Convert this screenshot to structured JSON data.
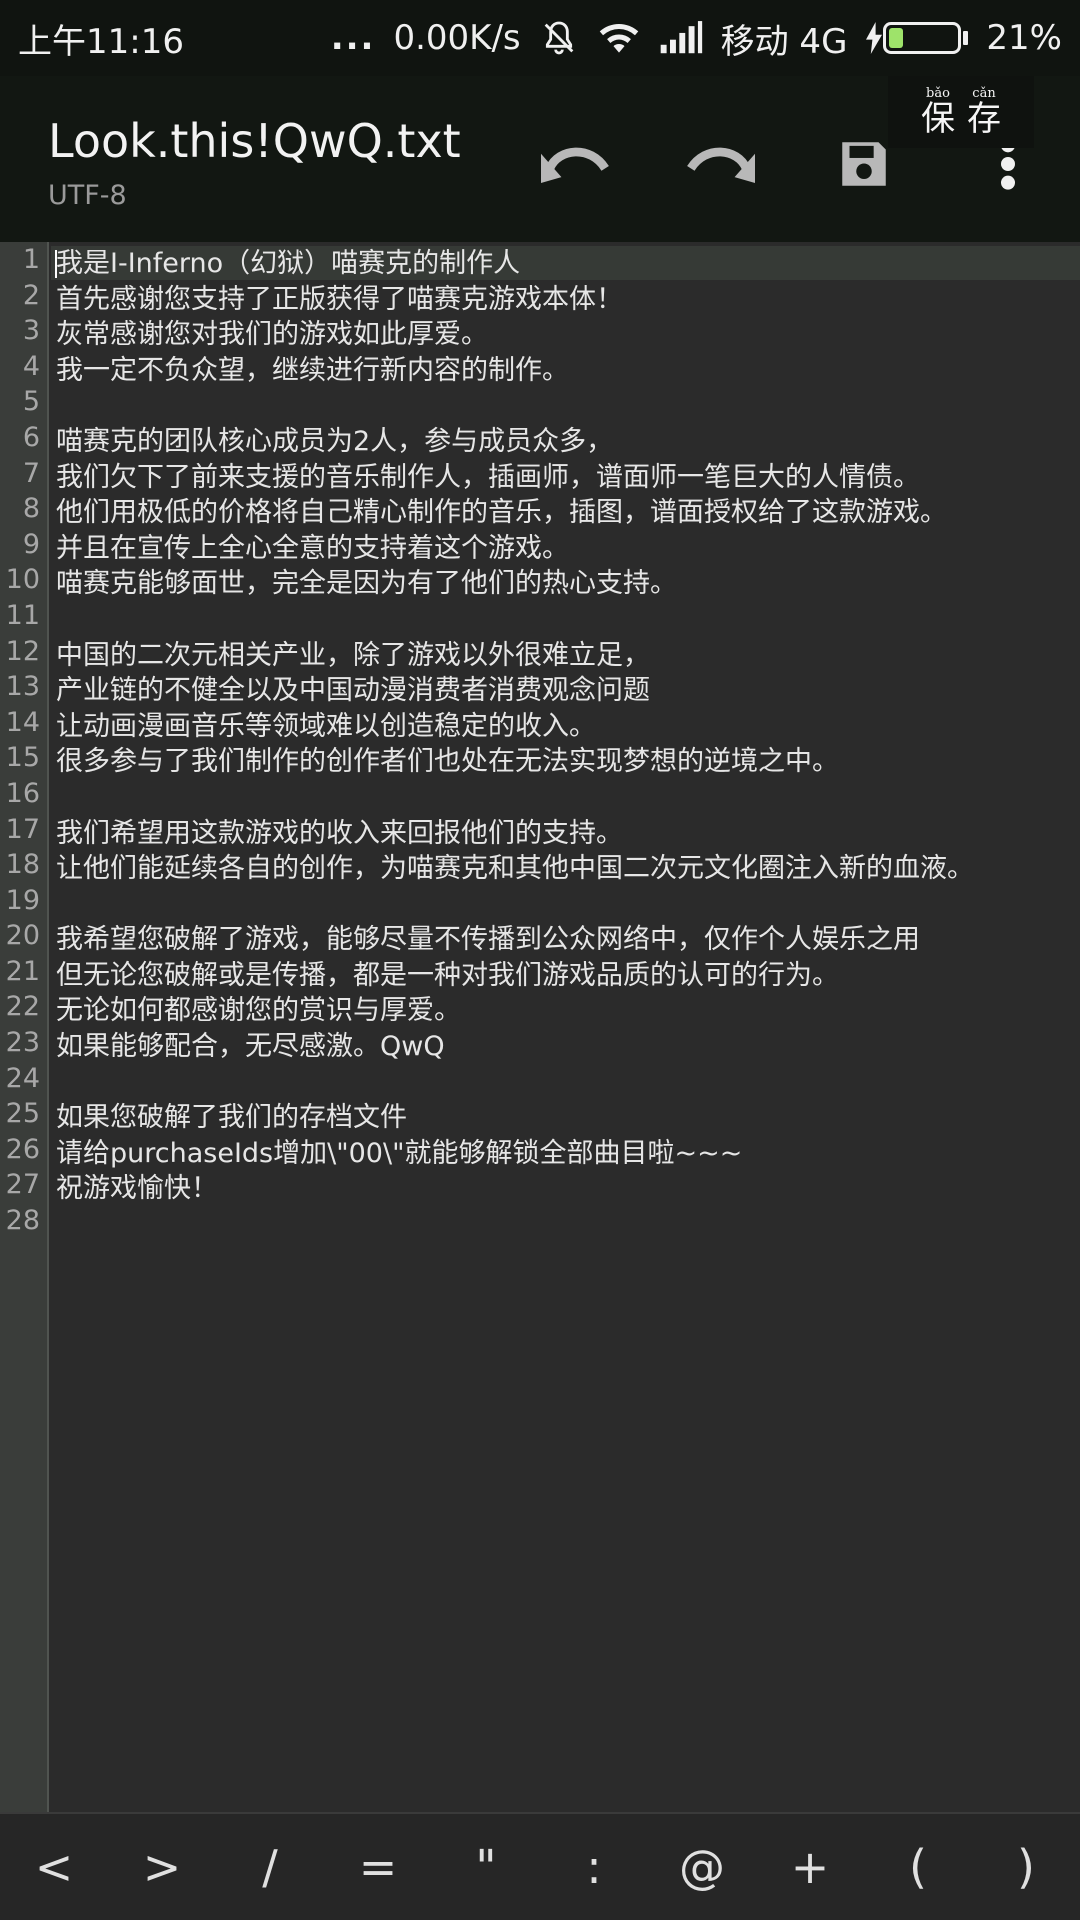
{
  "status_bar": {
    "time": "上午11:16",
    "dots": "...",
    "speed": "0.00K/s",
    "carrier": "移动 4G",
    "battery_percent": "21%",
    "battery_level": 0.21,
    "icons": [
      "bell-off-icon",
      "wifi-icon",
      "signal-icon",
      "charging-icon",
      "battery-icon"
    ]
  },
  "app_bar": {
    "title": "Look.this!QwQ.txt",
    "encoding": "UTF-8",
    "actions": [
      "undo-icon",
      "redo-icon",
      "save-icon",
      "more-vert-icon"
    ]
  },
  "ime_popup": {
    "candidates": [
      {
        "pinyin": "bǎo",
        "char": "保"
      },
      {
        "pinyin": "cǎn",
        "char": "存"
      }
    ]
  },
  "editor": {
    "line_numbers": [
      "1",
      "2",
      "3",
      "4",
      "5",
      "6",
      "7",
      "8",
      "9",
      "10",
      "11",
      "12",
      "13",
      "14",
      "15",
      "16",
      "17",
      "18",
      "19",
      "20",
      "21",
      "22",
      "23",
      "24",
      "25",
      "26",
      "27",
      "28"
    ],
    "lines": [
      "我是I-Inferno（幻狱）喵赛克的制作人",
      "首先感谢您支持了正版获得了喵赛克游戏本体！",
      "灰常感谢您对我们的游戏如此厚爱。",
      "我一定不负众望，继续进行新内容的制作。",
      "",
      "喵赛克的团队核心成员为2人，参与成员众多，",
      "我们欠下了前来支援的音乐制作人，插画师，谱面师一笔巨大的人情债。",
      "他们用极低的价格将自己精心制作的音乐，插图，谱面授权给了这款游戏。",
      "并且在宣传上全心全意的支持着这个游戏。",
      "喵赛克能够面世，完全是因为有了他们的热心支持。",
      "",
      "中国的二次元相关产业，除了游戏以外很难立足，",
      "产业链的不健全以及中国动漫消费者消费观念问题",
      "让动画漫画音乐等领域难以创造稳定的收入。",
      "很多参与了我们制作的创作者们也处在无法实现梦想的逆境之中。",
      "",
      "我们希望用这款游戏的收入来回报他们的支持。",
      "让他们能延续各自的创作，为喵赛克和其他中国二次元文化圈注入新的血液。",
      "",
      "我希望您破解了游戏，能够尽量不传播到公众网络中，仅作个人娱乐之用",
      "但无论您破解或是传播，都是一种对我们游戏品质的认可的行为。",
      "无论如何都感谢您的赏识与厚爱。",
      "如果能够配合，无尽感激。QwQ",
      "",
      "如果您破解了我们的存档文件",
      "请给purchaseIds增加\\\"00\\\"就能够解锁全部曲目啦~~~",
      "祝游戏愉快！",
      ""
    ]
  },
  "symbol_bar": {
    "keys": [
      "<",
      ">",
      "/",
      "=",
      "\"",
      ":",
      "@",
      "+",
      "(",
      ")"
    ]
  }
}
